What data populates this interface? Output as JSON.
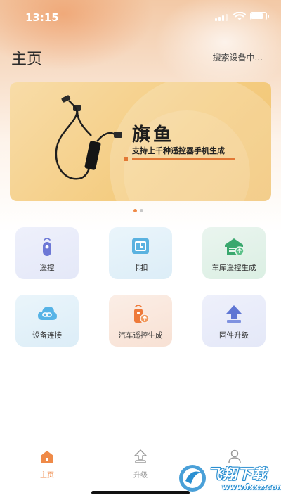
{
  "status_bar": {
    "time": "13:15"
  },
  "header": {
    "title": "主页",
    "search_placeholder": "搜索设备中..."
  },
  "banner": {
    "brand": "旗鱼",
    "subtitle": "支持上千种遥控器手机生成",
    "page_count": 2,
    "active_page": 1
  },
  "features": [
    {
      "label": "遥控",
      "icon": "remote-icon"
    },
    {
      "label": "卡扣",
      "icon": "card-buckle-icon"
    },
    {
      "label": "车库遥控生成",
      "icon": "garage-icon"
    },
    {
      "label": "设备连接",
      "icon": "cloud-link-icon"
    },
    {
      "label": "汽车遥控生成",
      "icon": "car-remote-icon"
    },
    {
      "label": "固件升级",
      "icon": "upload-icon"
    }
  ],
  "tabbar": {
    "items": [
      {
        "label": "主页",
        "icon": "home-icon",
        "active": true
      },
      {
        "label": "升级",
        "icon": "upgrade-icon",
        "active": false
      },
      {
        "label": "",
        "icon": "user-icon",
        "active": false
      }
    ]
  },
  "watermark": {
    "text": "飞翔下载",
    "url": "www.fxxz.com"
  },
  "colors": {
    "accent": "#ef8a48",
    "text": "#333333",
    "inactive": "#9a9a9a"
  }
}
